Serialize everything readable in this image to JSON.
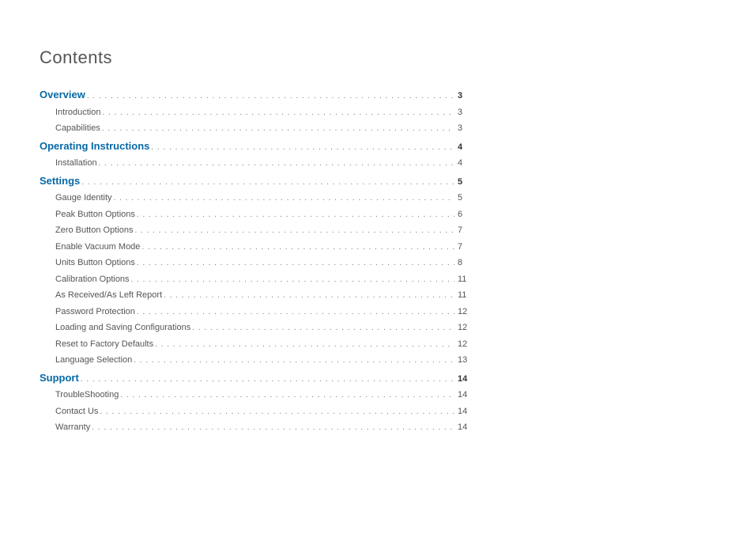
{
  "title": "Contents",
  "sections": [
    {
      "label": "Overview",
      "page": "3",
      "items": [
        {
          "label": "Introduction",
          "page": "3"
        },
        {
          "label": "Capabilities",
          "page": "3"
        }
      ]
    },
    {
      "label": "Operating Instructions",
      "page": "4",
      "items": [
        {
          "label": "Installation",
          "page": "4"
        }
      ]
    },
    {
      "label": "Settings",
      "page": "5",
      "items": [
        {
          "label": "Gauge Identity",
          "page": "5"
        },
        {
          "label": "Peak Button Options",
          "page": "6"
        },
        {
          "label": "Zero Button Options",
          "page": "7"
        },
        {
          "label": "Enable Vacuum Mode",
          "page": "7"
        },
        {
          "label": "Units Button Options",
          "page": "8"
        },
        {
          "label": "Calibration Options",
          "page": "11"
        },
        {
          "label": "As Received/As Left Report",
          "page": "11"
        },
        {
          "label": "Password Protection",
          "page": "12"
        },
        {
          "label": "Loading and Saving Configurations",
          "page": "12"
        },
        {
          "label": "Reset to Factory Defaults",
          "page": "12"
        },
        {
          "label": "Language Selection",
          "page": "13"
        }
      ]
    },
    {
      "label": "Support",
      "page": "14",
      "items": [
        {
          "label": "TroubleShooting",
          "page": "14"
        },
        {
          "label": "Contact Us",
          "page": "14"
        },
        {
          "label": "Warranty",
          "page": "14"
        }
      ]
    }
  ]
}
